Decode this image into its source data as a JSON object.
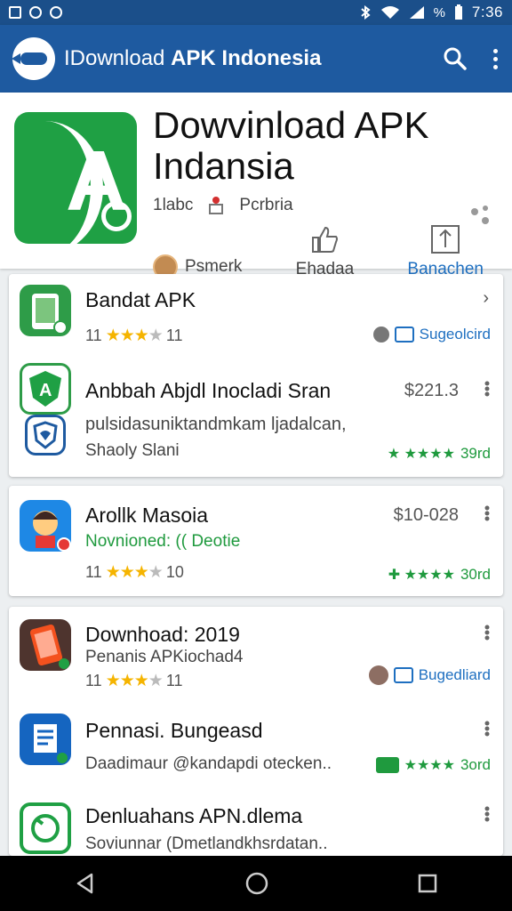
{
  "status_bar": {
    "time": "7:36",
    "battery_text": "%"
  },
  "app_bar": {
    "title_light": "IDownload ",
    "title_bold": "APK Indonesia"
  },
  "hero": {
    "title": "Dowvinload APK Indansia",
    "meta_left": "1labc",
    "meta_right": "Pcrbria",
    "developer": "Psmerk",
    "like_label": "Ehadaa",
    "action_label": "Banachen"
  },
  "card1": {
    "items": [
      {
        "title": "Bandat APK",
        "rating_count": "11",
        "rating_value": "11",
        "badge": "Sugeolcird"
      },
      {
        "title": "Anbbah Abjdl Inocladi Sran",
        "price": "$221.3",
        "desc": "pulsidasuniktandmkam ljadalcan,",
        "desc2": "Shaoly Slani",
        "green_rating": "39rd"
      }
    ]
  },
  "card2": {
    "items": [
      {
        "title": "Arollk Masoia",
        "price": "$10-028",
        "subtitle": "Novnioned: (( Deotie",
        "rating_count": "11",
        "rating_value": "10",
        "green_rating": "30rd"
      }
    ]
  },
  "card3": {
    "items": [
      {
        "title": "Downhoad: 2019",
        "subtitle": "Penanis APKiochad4",
        "rating_count": "11",
        "rating_value": "11",
        "badge": "Bugedliard"
      },
      {
        "title": "Pennasi. Bungeasd",
        "desc": "Daadimaur @kandapdi otecken..",
        "green_rating": "3ord"
      },
      {
        "title": "Denluahans APN.dlema",
        "desc": "Soviunnar (Dmetlandkhsrdatan.."
      }
    ]
  },
  "colors": {
    "primary": "#1e5aa0",
    "status_bar": "#1b4f8a",
    "green": "#1fa044",
    "star": "#f5b400"
  }
}
